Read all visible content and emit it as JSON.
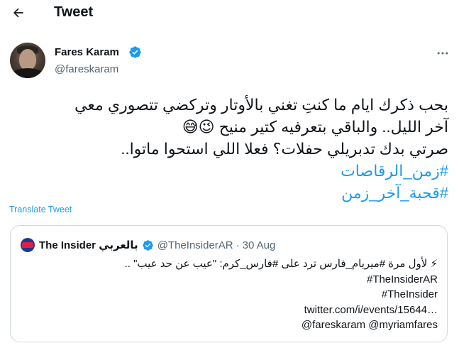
{
  "header": {
    "title": "Tweet"
  },
  "tweet": {
    "author": {
      "name": "Fares Karam",
      "handle": "@fareskaram"
    },
    "lines": [
      "بحب ذكرك ايام ما كنتِ تغني بالأوتار وتركضي تتصوري معي",
      "آخر الليل.. والباقي بتعرفيه كتير منيح 😉😅",
      "صرتي بدك تدبريلي حفلات؟ فعلا اللي استحوا ماتوا..",
      "#زمن_الرقاصات",
      "#قحبة_آخر_زمن"
    ],
    "translate_label": "Translate Tweet"
  },
  "quote": {
    "name": "The Insider بالعربي",
    "handle": "@TheInsiderAR",
    "separator": "·",
    "date": "30 Aug",
    "lines": [
      "⚡ لأول مرة #ميريام_فارس ترد على #فارس_كرم: \"عيب عن حد عيب\" ..",
      "#TheInsiderAR",
      "#TheInsider",
      "twitter.com/i/events/15644…",
      "@fareskaram @myriamfares"
    ]
  },
  "colors": {
    "accent": "#1d9bf0",
    "text": "#0f1419",
    "secondary": "#536471",
    "border": "#cfd9de"
  },
  "icons": {
    "back": "arrow-left-icon",
    "verified": "verified-badge-icon",
    "more": "more-horizontal-icon"
  }
}
